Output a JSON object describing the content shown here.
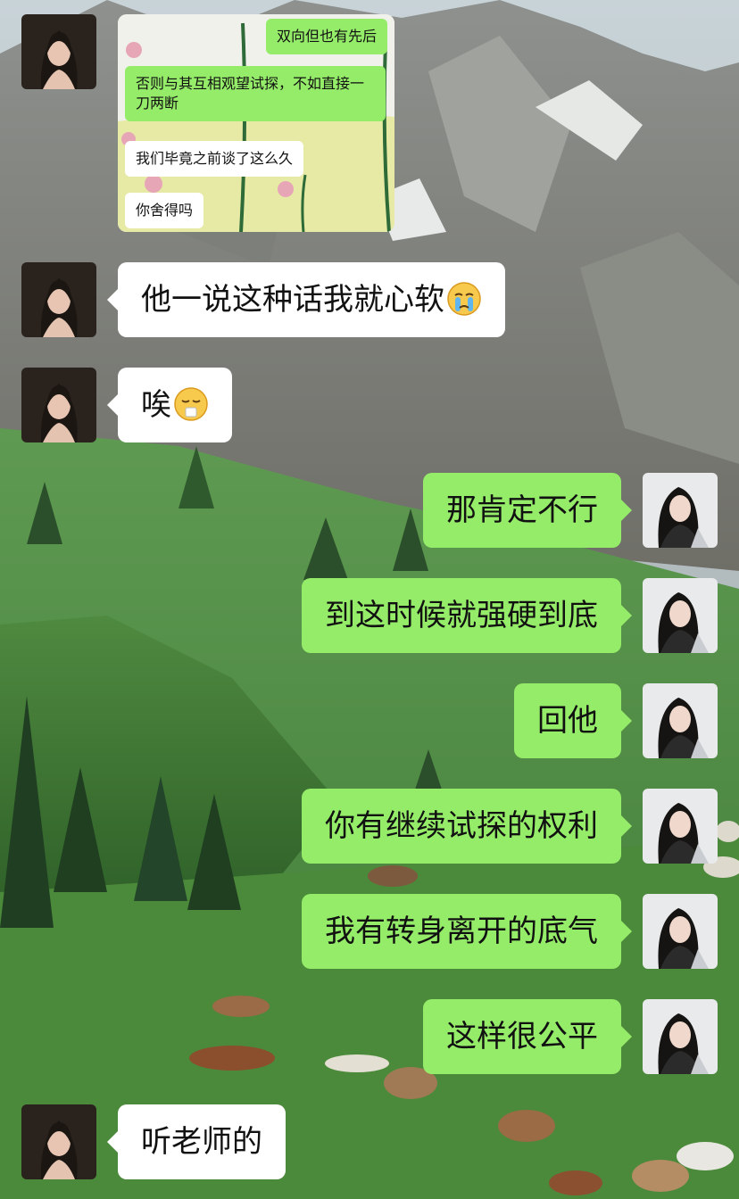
{
  "screenshot_messages": [
    {
      "side": "right",
      "text": "双向但也有先后"
    },
    {
      "side": "right",
      "text": "否则与其互相观望试探，不如直接一刀两断"
    },
    {
      "side": "left",
      "text": "我们毕竟之前谈了这么久"
    },
    {
      "side": "left",
      "text": "你舍得吗"
    }
  ],
  "messages": [
    {
      "side": "left",
      "text": "他一说这种话我就心软",
      "emoji": "crying-face-icon"
    },
    {
      "side": "left",
      "text": "唉",
      "emoji": "sneezing-face-icon"
    },
    {
      "side": "right",
      "text": "那肯定不行"
    },
    {
      "side": "right",
      "text": "到这时候就强硬到底"
    },
    {
      "side": "right",
      "text": "回他"
    },
    {
      "side": "right",
      "text": "你有继续试探的权利"
    },
    {
      "side": "right",
      "text": "我有转身离开的底气"
    },
    {
      "side": "right",
      "text": "这样很公平"
    },
    {
      "side": "left",
      "text": "听老师的"
    }
  ],
  "colors": {
    "outgoing_bubble": "#95ec69",
    "incoming_bubble": "#ffffff",
    "text": "#111111"
  }
}
